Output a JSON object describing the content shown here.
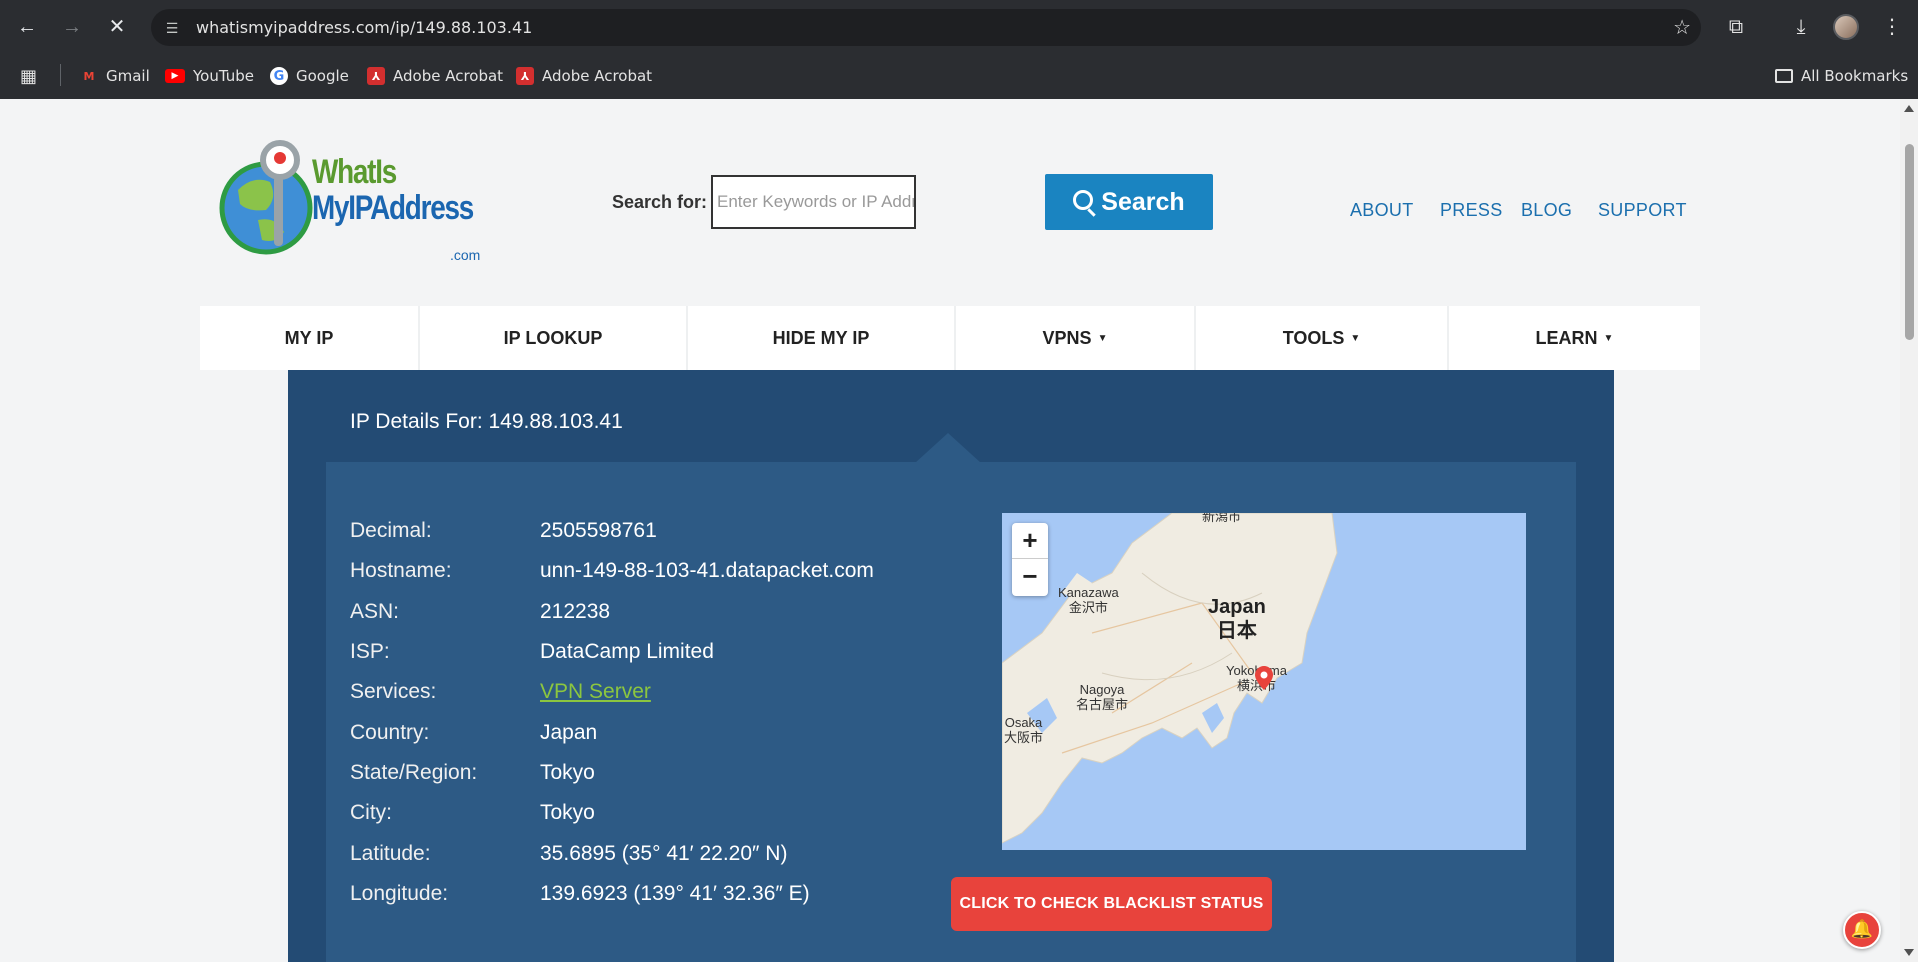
{
  "browser": {
    "url": "whatismyipaddress.com/ip/149.88.103.41",
    "bookmarks": [
      {
        "label": "Gmail",
        "icon": "gmail-icon"
      },
      {
        "label": "YouTube",
        "icon": "youtube-icon"
      },
      {
        "label": "Google",
        "icon": "google-icon"
      },
      {
        "label": "Adobe Acrobat",
        "icon": "acrobat-icon"
      },
      {
        "label": "Adobe Acrobat",
        "icon": "acrobat-icon"
      }
    ],
    "all_bookmarks": "All Bookmarks"
  },
  "site": {
    "logo": {
      "line1": "WhatIs",
      "line2": "MyIPAddress",
      "suffix": ".com"
    },
    "search": {
      "label": "Search for:",
      "placeholder": "Enter Keywords or IP Address",
      "button": "Search"
    },
    "top_links": [
      "ABOUT",
      "PRESS",
      "BLOG",
      "SUPPORT"
    ],
    "nav": [
      {
        "label": "MY IP",
        "dropdown": false
      },
      {
        "label": "IP LOOKUP",
        "dropdown": false
      },
      {
        "label": "HIDE MY IP",
        "dropdown": false
      },
      {
        "label": "VPNS",
        "dropdown": true
      },
      {
        "label": "TOOLS",
        "dropdown": true
      },
      {
        "label": "LEARN",
        "dropdown": true
      }
    ],
    "caret": "▼"
  },
  "details": {
    "title": "IP Details For: 149.88.103.41",
    "rows": [
      {
        "key": "Decimal:",
        "value": "2505598761"
      },
      {
        "key": "Hostname:",
        "value": "unn-149-88-103-41.datapacket.com"
      },
      {
        "key": "ASN:",
        "value": "212238"
      },
      {
        "key": "ISP:",
        "value": "DataCamp Limited"
      },
      {
        "key": "Services:",
        "value": "VPN Server"
      },
      {
        "key": "Country:",
        "value": "Japan"
      },
      {
        "key": "State/Region:",
        "value": "Tokyo"
      },
      {
        "key": "City:",
        "value": "Tokyo"
      },
      {
        "key": "Latitude:",
        "value": "35.6895 (35° 41′ 22.20″ N)"
      },
      {
        "key": "Longitude:",
        "value": "139.6923 (139° 41′ 32.36″ E)"
      }
    ],
    "blacklist_button": "CLICK TO CHECK BLACKLIST STATUS"
  },
  "map": {
    "zoom_in": "+",
    "zoom_out": "−",
    "labels": {
      "niigata": "新潟市",
      "kanazawa": "Kanazawa",
      "kanazawa_jp": "金沢市",
      "japan": "Japan",
      "japan_jp": "日本",
      "nagoya": "Nagoya",
      "nagoya_jp": "名古屋市",
      "yokohama": "Yokohama",
      "yokohama_jp": "横浜市",
      "osaka": "Osaka",
      "osaka_jp": "大阪市"
    }
  },
  "colors": {
    "panel": "#234b74",
    "inner": "#2d5a85",
    "accent": "#1a84c1",
    "alert": "#e8433c",
    "link_green": "#8cc63f"
  }
}
